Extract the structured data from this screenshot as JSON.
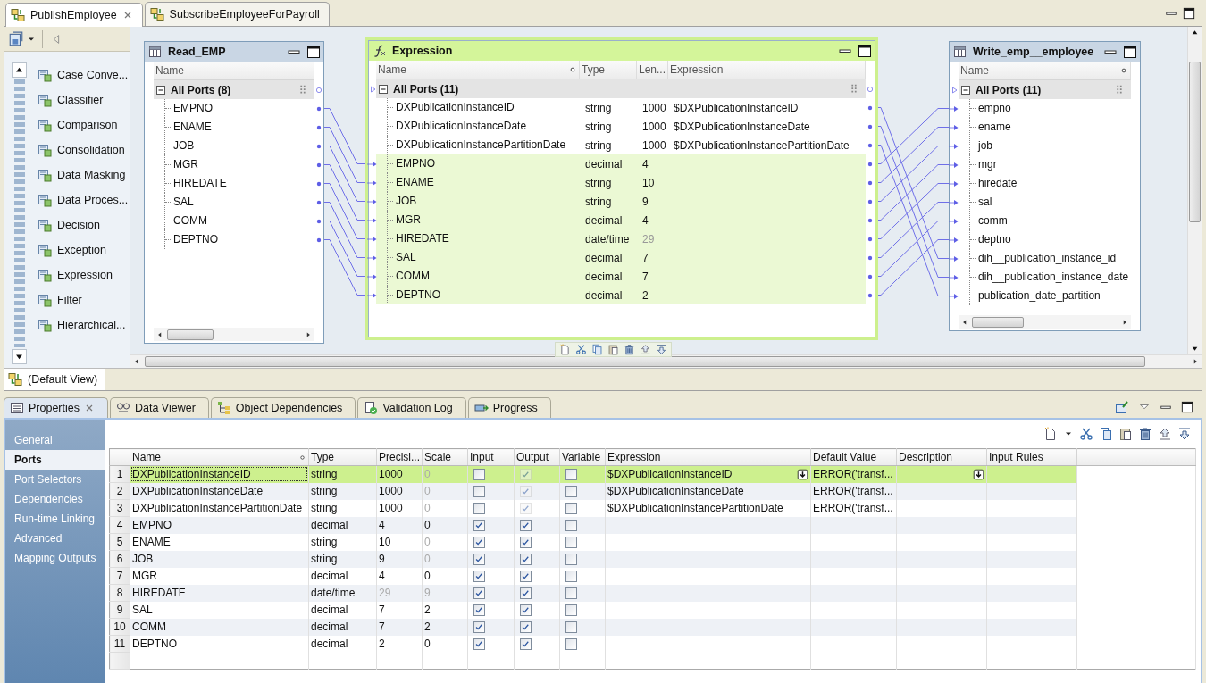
{
  "editor_tabs": [
    {
      "label": "PublishEmployee",
      "selected": true
    },
    {
      "label": "SubscribeEmployeeForPayroll",
      "selected": false
    }
  ],
  "palette": {
    "items": [
      "Case Conve...",
      "Classifier",
      "Comparison",
      "Consolidation",
      "Data Masking",
      "Data Proces...",
      "Decision",
      "Exception",
      "Expression",
      "Filter",
      "Hierarchical..."
    ]
  },
  "canvas": {
    "nodes": [
      {
        "kind": "source",
        "title": "Read_EMP",
        "columns": [
          "Name"
        ],
        "group": "All Ports (8)",
        "ports": [
          {
            "cells": [
              "EMPNO"
            ]
          },
          {
            "cells": [
              "ENAME"
            ]
          },
          {
            "cells": [
              "JOB"
            ]
          },
          {
            "cells": [
              "MGR"
            ]
          },
          {
            "cells": [
              "HIREDATE"
            ]
          },
          {
            "cells": [
              "SAL"
            ]
          },
          {
            "cells": [
              "COMM"
            ]
          },
          {
            "cells": [
              "DEPTNO"
            ]
          }
        ]
      },
      {
        "kind": "expression",
        "title": "Expression",
        "columns": [
          "Name",
          "Type",
          "Len...",
          "Expression"
        ],
        "group": "All Ports (11)",
        "ports": [
          {
            "cells": [
              "DXPublicationInstanceID",
              "string",
              "1000",
              "$DXPublicationInstanceID"
            ],
            "input": false,
            "length_dimmed": false
          },
          {
            "cells": [
              "DXPublicationInstanceDate",
              "string",
              "1000",
              "$DXPublicationInstanceDate"
            ],
            "input": false,
            "length_dimmed": false
          },
          {
            "cells": [
              "DXPublicationInstancePartitionDate",
              "string",
              "1000",
              "$DXPublicationInstancePartitionDate"
            ],
            "input": false,
            "length_dimmed": false
          },
          {
            "cells": [
              "EMPNO",
              "decimal",
              "4"
            ],
            "input": true,
            "length_dimmed": false
          },
          {
            "cells": [
              "ENAME",
              "string",
              "10"
            ],
            "input": true,
            "length_dimmed": false
          },
          {
            "cells": [
              "JOB",
              "string",
              "9"
            ],
            "input": true,
            "length_dimmed": false
          },
          {
            "cells": [
              "MGR",
              "decimal",
              "4"
            ],
            "input": true,
            "length_dimmed": false
          },
          {
            "cells": [
              "HIREDATE",
              "date/time",
              "29"
            ],
            "input": true,
            "length_dimmed": true
          },
          {
            "cells": [
              "SAL",
              "decimal",
              "7"
            ],
            "input": true,
            "length_dimmed": false
          },
          {
            "cells": [
              "COMM",
              "decimal",
              "7"
            ],
            "input": true,
            "length_dimmed": false
          },
          {
            "cells": [
              "DEPTNO",
              "decimal",
              "2"
            ],
            "input": true,
            "length_dimmed": false
          }
        ]
      },
      {
        "kind": "target",
        "title": "Write_emp__employee",
        "columns": [
          "Name"
        ],
        "group": "All Ports (11)",
        "ports": [
          {
            "cells": [
              "empno"
            ]
          },
          {
            "cells": [
              "ename"
            ]
          },
          {
            "cells": [
              "job"
            ]
          },
          {
            "cells": [
              "mgr"
            ]
          },
          {
            "cells": [
              "hiredate"
            ]
          },
          {
            "cells": [
              "sal"
            ]
          },
          {
            "cells": [
              "comm"
            ]
          },
          {
            "cells": [
              "deptno"
            ]
          },
          {
            "cells": [
              "dih__publication_instance_id"
            ]
          },
          {
            "cells": [
              "dih__publication_instance_date"
            ]
          },
          {
            "cells": [
              "publication_date_partition"
            ]
          }
        ]
      }
    ]
  },
  "view_tab": "(Default View)",
  "properties": {
    "tabs": [
      {
        "label": "Properties",
        "selected": true
      },
      {
        "label": "Data Viewer",
        "selected": false
      },
      {
        "label": "Object Dependencies",
        "selected": false
      },
      {
        "label": "Validation Log",
        "selected": false
      },
      {
        "label": "Progress",
        "selected": false
      }
    ],
    "nav": [
      {
        "label": "General",
        "selected": false
      },
      {
        "label": "Ports",
        "selected": true
      },
      {
        "label": "Port Selectors",
        "selected": false
      },
      {
        "label": "Dependencies",
        "selected": false
      },
      {
        "label": "Run-time Linking",
        "selected": false
      },
      {
        "label": "Advanced",
        "selected": false
      },
      {
        "label": "Mapping Outputs",
        "selected": false
      }
    ],
    "table": {
      "columns": [
        "Name",
        "Type",
        "Precisi...",
        "Scale",
        "Input",
        "Output",
        "Variable",
        "Expression",
        "Default Value",
        "Description",
        "Input Rules"
      ],
      "rows": [
        {
          "number": "1",
          "name": "DXPublicationInstanceID",
          "type": "string",
          "precision": "1000",
          "precision_dimmed": false,
          "scale": "0",
          "scale_dimmed": true,
          "input": false,
          "output": true,
          "output_disabled": true,
          "variable": false,
          "expression": "$DXPublicationInstanceID",
          "default_value": "ERROR('transf...",
          "selected": true
        },
        {
          "number": "2",
          "name": "DXPublicationInstanceDate",
          "type": "string",
          "precision": "1000",
          "precision_dimmed": false,
          "scale": "0",
          "scale_dimmed": true,
          "input": false,
          "output": true,
          "output_disabled": true,
          "variable": false,
          "expression": "$DXPublicationInstanceDate",
          "default_value": "ERROR('transf...",
          "selected": false
        },
        {
          "number": "3",
          "name": "DXPublicationInstancePartitionDate",
          "type": "string",
          "precision": "1000",
          "precision_dimmed": false,
          "scale": "0",
          "scale_dimmed": true,
          "input": false,
          "output": true,
          "output_disabled": true,
          "variable": false,
          "expression": "$DXPublicationInstancePartitionDate",
          "default_value": "ERROR('transf...",
          "selected": false
        },
        {
          "number": "4",
          "name": "EMPNO",
          "type": "decimal",
          "precision": "4",
          "precision_dimmed": false,
          "scale": "0",
          "scale_dimmed": false,
          "input": true,
          "output": true,
          "output_disabled": false,
          "variable": false,
          "selected": false
        },
        {
          "number": "5",
          "name": "ENAME",
          "type": "string",
          "precision": "10",
          "precision_dimmed": false,
          "scale": "0",
          "scale_dimmed": true,
          "input": true,
          "output": true,
          "output_disabled": false,
          "variable": false,
          "selected": false
        },
        {
          "number": "6",
          "name": "JOB",
          "type": "string",
          "precision": "9",
          "precision_dimmed": false,
          "scale": "0",
          "scale_dimmed": true,
          "input": true,
          "output": true,
          "output_disabled": false,
          "variable": false,
          "selected": false
        },
        {
          "number": "7",
          "name": "MGR",
          "type": "decimal",
          "precision": "4",
          "precision_dimmed": false,
          "scale": "0",
          "scale_dimmed": false,
          "input": true,
          "output": true,
          "output_disabled": false,
          "variable": false,
          "selected": false
        },
        {
          "number": "8",
          "name": "HIREDATE",
          "type": "date/time",
          "precision": "29",
          "precision_dimmed": true,
          "scale": "9",
          "scale_dimmed": true,
          "input": true,
          "output": true,
          "output_disabled": false,
          "variable": false,
          "selected": false
        },
        {
          "number": "9",
          "name": "SAL",
          "type": "decimal",
          "precision": "7",
          "precision_dimmed": false,
          "scale": "2",
          "scale_dimmed": false,
          "input": true,
          "output": true,
          "output_disabled": false,
          "variable": false,
          "selected": false
        },
        {
          "number": "10",
          "name": "COMM",
          "type": "decimal",
          "precision": "7",
          "precision_dimmed": false,
          "scale": "2",
          "scale_dimmed": false,
          "input": true,
          "output": true,
          "output_disabled": false,
          "variable": false,
          "selected": false
        },
        {
          "number": "11",
          "name": "DEPTNO",
          "type": "decimal",
          "precision": "2",
          "precision_dimmed": false,
          "scale": "0",
          "scale_dimmed": false,
          "input": true,
          "output": true,
          "output_disabled": false,
          "variable": false,
          "selected": false
        }
      ]
    }
  }
}
